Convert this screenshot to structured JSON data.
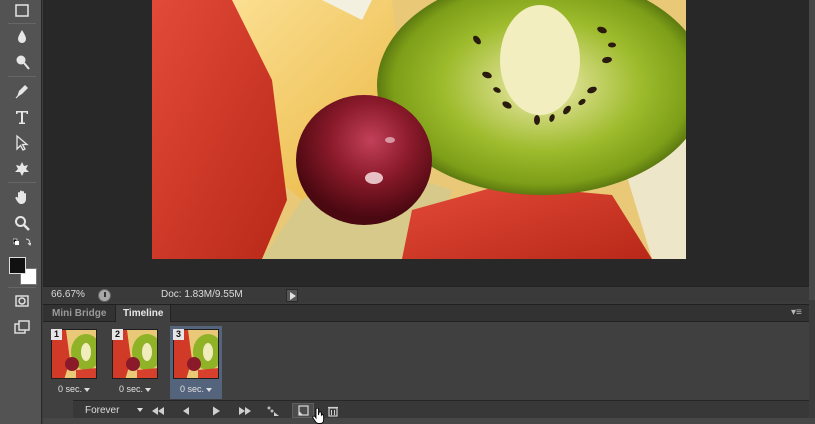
{
  "status": {
    "zoom": "66.67%",
    "doc_size": "Doc: 1.83M/9.55M"
  },
  "panel": {
    "tabs": [
      {
        "label": "Mini Bridge"
      },
      {
        "label": "Timeline"
      }
    ],
    "frames": [
      {
        "number": "1",
        "delay": "0 sec."
      },
      {
        "number": "2",
        "delay": "0 sec."
      },
      {
        "number": "3",
        "delay": "0 sec."
      }
    ],
    "loop": "Forever"
  },
  "colors": {
    "accent_selected": "#54647d",
    "panel_bg": "#404040",
    "toolbar_bg": "#535353"
  },
  "icons": {
    "tools": [
      "marquee-icon",
      "blur-icon",
      "dodge-icon",
      "pen-icon",
      "type-icon",
      "path-select-icon",
      "shape-icon",
      "hand-icon",
      "zoom-icon",
      "swap-colors-icon",
      "color-swatches-icon",
      "quick-mask-icon",
      "screen-mode-icon"
    ],
    "controls": [
      "first-frame-icon",
      "previous-frame-icon",
      "play-icon",
      "next-frame-icon",
      "tween-icon",
      "duplicate-frame-icon",
      "trash-icon"
    ]
  }
}
